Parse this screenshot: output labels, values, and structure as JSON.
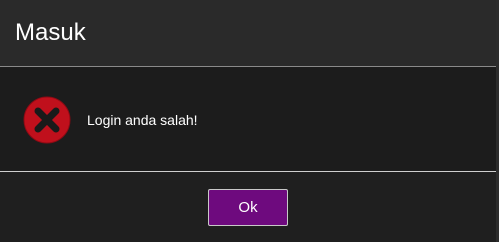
{
  "dialog": {
    "title": "Masuk",
    "message": "Login anda salah!",
    "icon": "error-x-icon",
    "ok_label": "Ok"
  },
  "colors": {
    "header_bg": "#2a2a2a",
    "body_bg": "#1c1c1c",
    "accent_button": "#6e0a7e",
    "error_icon": "#c0101c"
  }
}
